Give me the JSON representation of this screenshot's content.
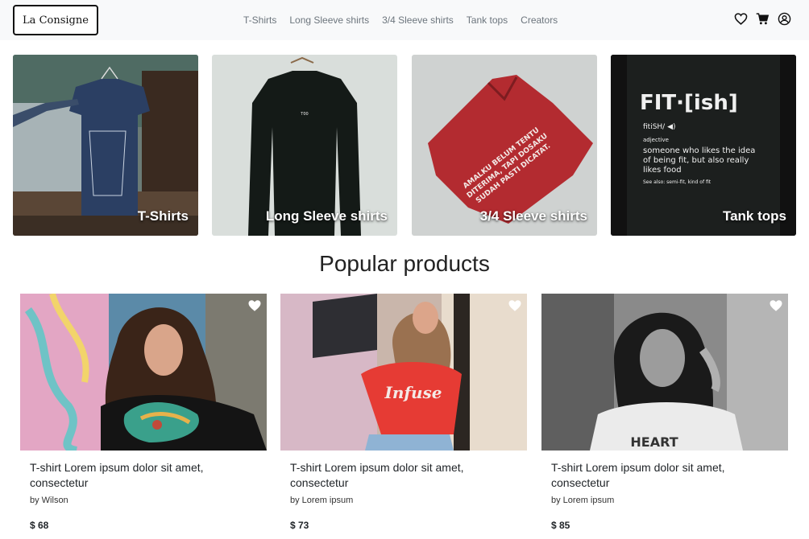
{
  "brand": "La Consigne",
  "nav": {
    "links": [
      "T-Shirts",
      "Long Sleeve shirts",
      "3/4 Sleeve shirts",
      "Tank tops",
      "Creators"
    ],
    "icons": [
      "heart-icon",
      "cart-icon",
      "user-icon"
    ]
  },
  "categories": [
    {
      "label": "T-Shirts"
    },
    {
      "label": "Long Sleeve shirts"
    },
    {
      "label": "3/4 Sleeve shirts"
    },
    {
      "label": "Tank tops"
    }
  ],
  "popular": {
    "title": "Popular products",
    "products": [
      {
        "title": "T-shirt Lorem ipsum dolor sit amet, consectetur",
        "creator": "by Wilson",
        "price": "$ 68"
      },
      {
        "title": "T-shirt Lorem ipsum dolor sit amet, consectetur",
        "creator": "by Lorem ipsum",
        "price": "$ 73"
      },
      {
        "title": "T-shirt Lorem ipsum dolor sit amet, consectetur",
        "creator": "by Lorem ipsum",
        "price": "$ 85"
      }
    ]
  },
  "colors": {
    "navbar_bg": "#f8f9fa",
    "nav_text": "#6c757d",
    "text": "#212529"
  }
}
